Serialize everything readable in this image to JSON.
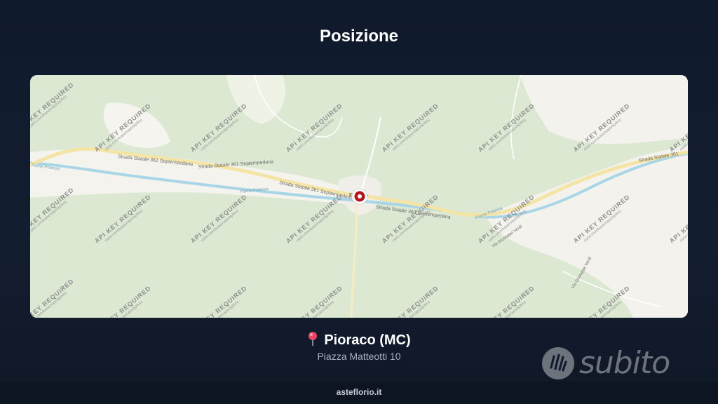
{
  "header": {
    "title": "Posizione"
  },
  "map": {
    "watermark_main": "API KEY REQUIRED",
    "watermark_sub": "carto.com/basemaps/apikey",
    "road_labels": [
      "Strada Statale 361 Septempedana",
      "Strada Statale 361 Septempedana",
      "Strada Statale 361 Septempedana",
      "Strada Statale 361 Septempedana",
      "Strada Statale 361"
    ],
    "river_labels": [
      "Fiume Potenza",
      "Fiume Potenza",
      "Fiume Potenza"
    ],
    "street_labels": [
      "Via Giuseppe Verdi",
      "Via Giuseppe Verdi"
    ],
    "town_label": "Pioraco",
    "marker_color": "#b3151f"
  },
  "location": {
    "pin_icon": "pushpin-icon",
    "name": "Pioraco (MC)",
    "address": "Piazza Matteotti 10"
  },
  "brand": {
    "name": "subito",
    "icon": "subito-hand-icon"
  },
  "footer": {
    "text": "asteflorio.it"
  }
}
